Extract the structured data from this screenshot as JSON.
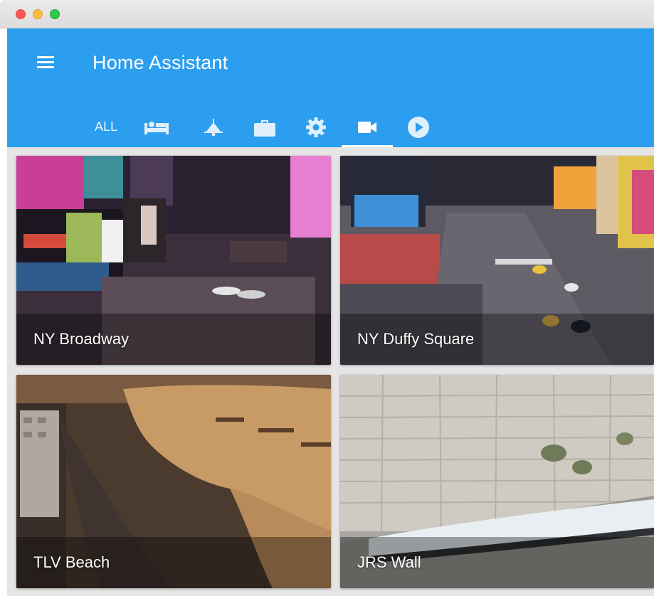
{
  "window": {
    "controls": [
      "close",
      "minimize",
      "maximize"
    ]
  },
  "header": {
    "title": "Home Assistant",
    "background_color": "#2c9ef0",
    "menu_icon": "hamburger-menu-icon"
  },
  "tabs": [
    {
      "label": "ALL",
      "icon": null,
      "selected": false
    },
    {
      "label": null,
      "icon": "bed-icon",
      "selected": false
    },
    {
      "label": null,
      "icon": "ceiling-lamp-icon",
      "selected": false
    },
    {
      "label": null,
      "icon": "briefcase-icon",
      "selected": false
    },
    {
      "label": null,
      "icon": "gear-icon",
      "selected": false
    },
    {
      "label": null,
      "icon": "video-camera-icon",
      "selected": true
    },
    {
      "label": null,
      "icon": "play-circle-icon",
      "selected": false
    }
  ],
  "cameras": [
    {
      "name": "NY Broadway"
    },
    {
      "name": "NY Duffy Square"
    },
    {
      "name": "TLV Beach"
    },
    {
      "name": "JRS Wall"
    }
  ]
}
